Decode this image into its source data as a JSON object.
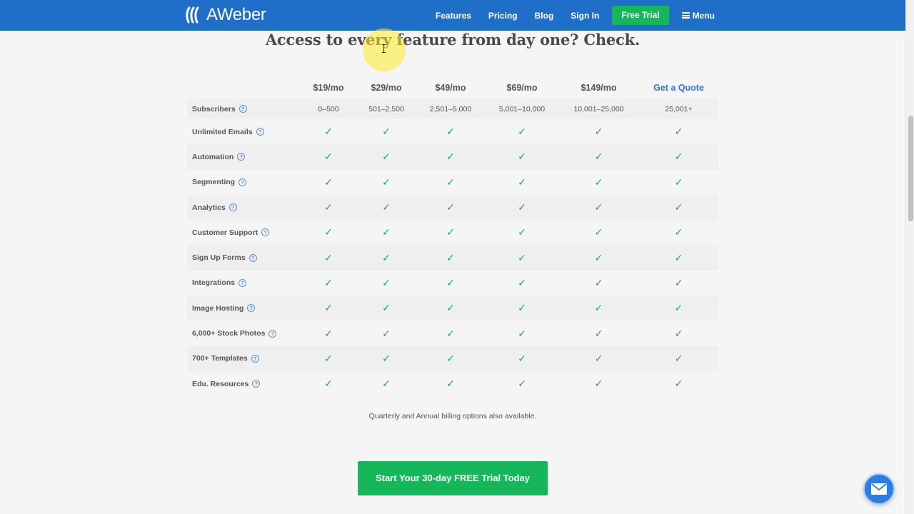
{
  "nav": {
    "brand": "AWeber",
    "links": [
      "Features",
      "Pricing",
      "Blog",
      "Sign In"
    ],
    "cta": "Free Trial",
    "menu": "Menu"
  },
  "heading": "Access to every feature from day one? Check.",
  "table": {
    "plans": [
      "$19/mo",
      "$29/mo",
      "$49/mo",
      "$69/mo",
      "$149/mo",
      "Get a Quote"
    ],
    "subscribers_label": "Subscribers",
    "subscribers": [
      "0–500",
      "501–2,500",
      "2,501–5,000",
      "5,001–10,000",
      "10,001–25,000",
      "25,001+"
    ],
    "features": [
      "Unlimited Emails",
      "Automation",
      "Segmenting",
      "Analytics",
      "Customer Support",
      "Sign Up Forms",
      "Integrations",
      "Image Hosting",
      "6,000+ Stock Photos",
      "700+ Templates",
      "Edu. Resources"
    ],
    "check_glyph": "✓",
    "help_glyph": "?"
  },
  "note": "Quarterly and Annual billing options also available.",
  "cta_button": "Start Your 30-day FREE Trial Today",
  "colors": {
    "nav_blue": "#1f6fc9",
    "green": "#16b75a",
    "check_green": "#18a862",
    "link_blue": "#3a79c9"
  },
  "icons": {
    "chat": "envelope-icon",
    "help": "help-circle-icon",
    "menu": "hamburger-icon"
  }
}
